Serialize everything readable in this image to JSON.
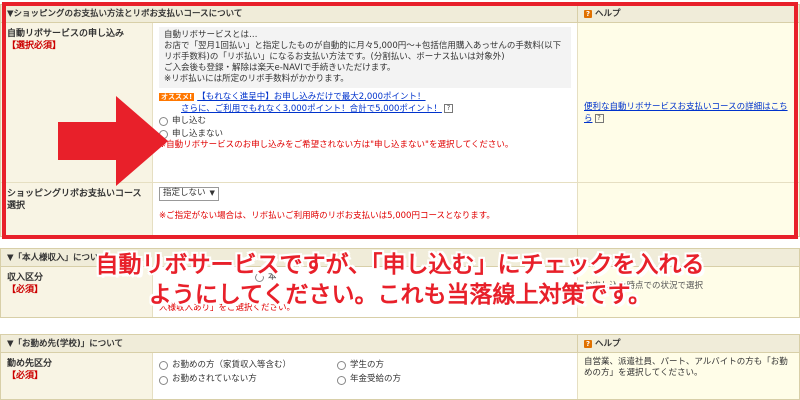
{
  "payment": {
    "header": "▼ショッピングのお支払い方法とリボお支払いコースについて",
    "help_header": "ヘルプ",
    "auto_revo": {
      "label": "自動リボサービスの申し込み",
      "required": "【選択必須】",
      "info_lines": [
        "自動リボサービスとは…",
        "お店で「翌月1回払い」と指定したものが自動的に月々5,000円〜+包括信用購入あっせんの手数料(以下リボ手数料)の「リボ払い」になるお支払い方法です。(分割払い、ボーナス払いは対象外)",
        "ご入会後も登録・解除は楽天e-NAVIで手続きいただけます。",
        "※リボ払いには所定のリボ手数料がかかります。"
      ],
      "promo_tag": "オススメ!",
      "promo_line1": "【もれなく進呈中】お申し込みだけで最大2,000ポイント！",
      "promo_line2": "さらに、ご利用でもれなく3,000ポイント！合計で5,000ポイント！",
      "option_yes": "申し込む",
      "option_no": "申し込まない",
      "note": "※自動リボサービスのお申し込みをご希望されない方は\"申し込まない\"を選択してください。",
      "help_link": "便利な自動リボサービスお支払いコースの詳細はこちら"
    },
    "revo_course": {
      "label": "ショッピングリボお支払いコース選択",
      "select_value": "指定しない",
      "note": "※ご指定がない場合は、リボ払いご利用時のリボお支払いは5,000円コースとなります。"
    }
  },
  "personal": {
    "header": "▼「本人様収入」について",
    "label": "収入区分",
    "required": "【必須】",
    "option_partial": "本",
    "help_text": "お申し込み時点での状況で選択",
    "note": "人様収入あり」をご選択ください。"
  },
  "workplace": {
    "header": "▼「お勤め先(学校)」について",
    "help_header": "ヘルプ",
    "label": "勤め先区分",
    "required": "【必須】",
    "options": [
      "お勤めの方（家賃収入等含む）",
      "学生の方",
      "お勤めされていない方",
      "年金受給の方"
    ],
    "help_text": "自営業、派遣社員、パート、アルバイトの方も「お勤めの方」を選択してください。"
  },
  "overlay": {
    "line1": "自動リボサービスですが、「申し込む」にチェックを入れる",
    "line2": "ようにしてください。これも当落線上対策です。"
  },
  "colors": {
    "highlight_red": "#e8202a",
    "header_bg": "#f0ecd9",
    "link_blue": "#0033cc"
  }
}
